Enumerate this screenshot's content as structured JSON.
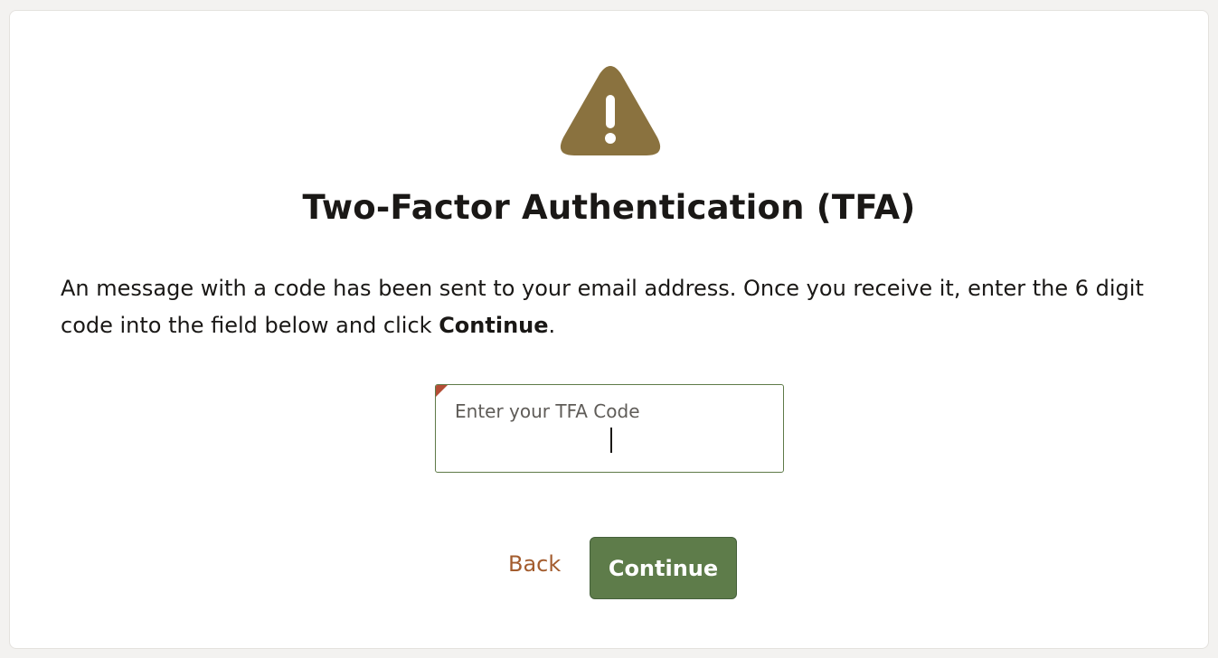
{
  "header": {
    "icon": "warning-icon",
    "icon_color": "#8a723f",
    "title": "Two-Factor Authentication (TFA)"
  },
  "message": {
    "text_before": "An message with a code has been sent to your email address. Once you receive it, enter the 6 digit code into the field below and click ",
    "bold_word": "Continue",
    "text_after": "."
  },
  "tfa_field": {
    "label": "Enter your TFA Code",
    "value": "",
    "required": true,
    "required_marker_color": "#b34d35"
  },
  "actions": {
    "back_label": "Back",
    "continue_label": "Continue",
    "back_color": "#a35c2e",
    "continue_color": "#5e7c4a"
  }
}
